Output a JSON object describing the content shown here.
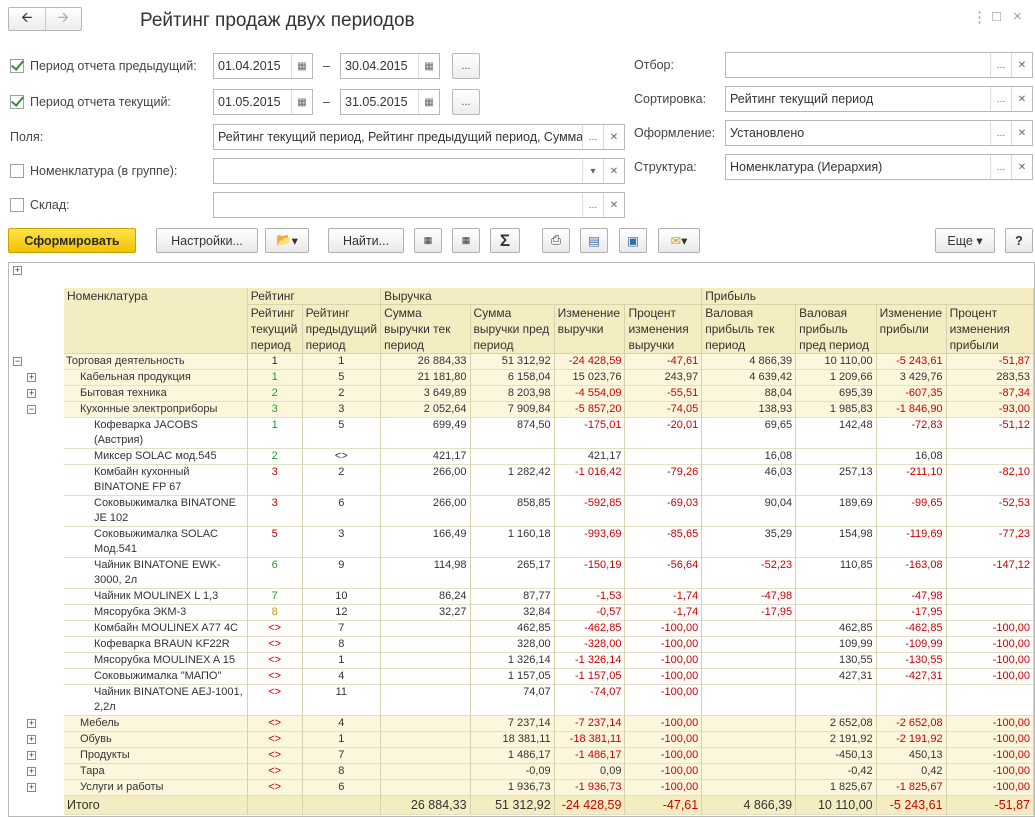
{
  "window": {
    "title": "Рейтинг продаж двух периодов",
    "back_icon": "arrow-left-icon",
    "fwd_icon": "arrow-right-icon",
    "more": "⋮",
    "maximize": "□",
    "close": "×"
  },
  "filters": {
    "prev_period": {
      "label": "Период отчета предыдущий:",
      "from": "01.04.2015",
      "to": "30.04.2015",
      "checked": true
    },
    "cur_period": {
      "label": "Период отчета текущий:",
      "from": "01.05.2015",
      "to": "31.05.2015",
      "checked": true
    },
    "dash": "–",
    "fields": {
      "label": "Поля:",
      "value": "Рейтинг текущий период, Рейтинг предыдущий период, Сумма"
    },
    "nomenclature": {
      "label": "Номенклатура (в группе):",
      "value": ""
    },
    "warehouse": {
      "label": "Склад:",
      "value": ""
    },
    "selection": {
      "label": "Отбор:",
      "value": ""
    },
    "sort": {
      "label": "Сортировка:",
      "value": "Рейтинг текущий период"
    },
    "design": {
      "label": "Оформление:",
      "value": "Установлено"
    },
    "structure": {
      "label": "Структура:",
      "value": "Номенклатура (Иерархия)"
    }
  },
  "toolbar": {
    "generate": "Сформировать",
    "settings": "Настройки...",
    "find": "Найти...",
    "more": "Еще",
    "help": "?"
  },
  "table": {
    "headers": {
      "nom": "Номенклатура",
      "rating": "Рейтинг",
      "revenue": "Выручка",
      "profit": "Прибыль",
      "r_cur": "Рейтинг текущий период",
      "r_prev": "Рейтинг предыдущий период",
      "rev_cur": "Сумма выручки тек период",
      "rev_prev": "Сумма выручки пред период",
      "rev_chg": "Изменение выручки",
      "rev_pct": "Процент изменения выручки",
      "pr_cur": "Валовая прибыль тек период",
      "pr_prev": "Валовая прибыль пред период",
      "pr_chg": "Изменение прибыли",
      "pr_pct": "Процент изменения прибыли"
    },
    "rows": [
      {
        "lvl": 0,
        "grp": true,
        "name": "Торговая деятельность",
        "rc": "1",
        "rp": "1",
        "a": "26 884,33",
        "b": "51 312,92",
        "c": "-24 428,59",
        "d": "-47,61",
        "e": "4 866,39",
        "f": "10 110,00",
        "g": "-5 243,61",
        "h": "-51,87"
      },
      {
        "lvl": 1,
        "grp": true,
        "name": "Кабельная продукция",
        "rc": "1",
        "rp": "5",
        "a": "21 181,80",
        "b": "6 158,04",
        "c": "15 023,76",
        "d": "243,97",
        "e": "4 639,42",
        "f": "1 209,66",
        "g": "3 429,76",
        "h": "283,53"
      },
      {
        "lvl": 1,
        "grp": true,
        "name": "Бытовая техника",
        "rc": "2",
        "rp": "2",
        "a": "3 649,89",
        "b": "8 203,98",
        "c": "-4 554,09",
        "d": "-55,51",
        "e": "88,04",
        "f": "695,39",
        "g": "-607,35",
        "h": "-87,34"
      },
      {
        "lvl": 1,
        "grp": true,
        "name": "Кухонные электроприборы",
        "rc": "3",
        "rp": "3",
        "a": "2 052,64",
        "b": "7 909,84",
        "c": "-5 857,20",
        "d": "-74,05",
        "e": "138,93",
        "f": "1 985,83",
        "g": "-1 846,90",
        "h": "-93,00"
      },
      {
        "lvl": 2,
        "name": "Кофеварка JACOBS (Австрия)",
        "rc": "1",
        "rp": "5",
        "a": "699,49",
        "b": "874,50",
        "c": "-175,01",
        "d": "-20,01",
        "e": "69,65",
        "f": "142,48",
        "g": "-72,83",
        "h": "-51,12"
      },
      {
        "lvl": 2,
        "name": "Миксер SOLAC мод.545",
        "rc": "2",
        "rp": "<>",
        "a": "421,17",
        "b": "",
        "c": "421,17",
        "d": "",
        "e": "16,08",
        "f": "",
        "g": "16,08",
        "h": ""
      },
      {
        "lvl": 2,
        "name": "Комбайн кухонный BINATONE FP 67",
        "rc": "3",
        "rp": "2",
        "a": "266,00",
        "b": "1 282,42",
        "c": "-1 016,42",
        "d": "-79,26",
        "e": "46,03",
        "f": "257,13",
        "g": "-211,10",
        "h": "-82,10"
      },
      {
        "lvl": 2,
        "name": "Соковыжималка BINATONE JE 102",
        "rc": "3",
        "rp": "6",
        "a": "266,00",
        "b": "858,85",
        "c": "-592,85",
        "d": "-69,03",
        "e": "90,04",
        "f": "189,69",
        "g": "-99,65",
        "h": "-52,53"
      },
      {
        "lvl": 2,
        "name": "Соковыжималка SOLAC Мод.541",
        "rc": "5",
        "rp": "3",
        "a": "166,49",
        "b": "1 160,18",
        "c": "-993,69",
        "d": "-85,65",
        "e": "35,29",
        "f": "154,98",
        "g": "-119,69",
        "h": "-77,23"
      },
      {
        "lvl": 2,
        "name": "Чайник BINATONE EWK-3000, 2л",
        "rc": "6",
        "rp": "9",
        "a": "114,98",
        "b": "265,17",
        "c": "-150,19",
        "d": "-56,64",
        "e": "-52,23",
        "f": "110,85",
        "g": "-163,08",
        "h": "-147,12"
      },
      {
        "lvl": 2,
        "name": "Чайник MOULINEX L 1,3",
        "rc": "7",
        "rp": "10",
        "a": "86,24",
        "b": "87,77",
        "c": "-1,53",
        "d": "-1,74",
        "e": "-47,98",
        "f": "",
        "g": "-47,98",
        "h": ""
      },
      {
        "lvl": 2,
        "name": "Мясорубка ЭКМ-3",
        "rc": "8",
        "rp": "12",
        "a": "32,27",
        "b": "32,84",
        "c": "-0,57",
        "d": "-1,74",
        "e": "-17,95",
        "f": "",
        "g": "-17,95",
        "h": ""
      },
      {
        "lvl": 2,
        "name": "Комбайн MOULINEX A77 4C",
        "rc": "<>",
        "rp": "7",
        "a": "",
        "b": "462,85",
        "c": "-462,85",
        "d": "-100,00",
        "e": "",
        "f": "462,85",
        "g": "-462,85",
        "h": "-100,00"
      },
      {
        "lvl": 2,
        "name": "Кофеварка BRAUN KF22R",
        "rc": "<>",
        "rp": "8",
        "a": "",
        "b": "328,00",
        "c": "-328,00",
        "d": "-100,00",
        "e": "",
        "f": "109,99",
        "g": "-109,99",
        "h": "-100,00"
      },
      {
        "lvl": 2,
        "name": "Мясорубка MOULINEX A 15",
        "rc": "<>",
        "rp": "1",
        "a": "",
        "b": "1 326,14",
        "c": "-1 326,14",
        "d": "-100,00",
        "e": "",
        "f": "130,55",
        "g": "-130,55",
        "h": "-100,00"
      },
      {
        "lvl": 2,
        "name": "Соковыжималка \"МАПО\"",
        "rc": "<>",
        "rp": "4",
        "a": "",
        "b": "1 157,05",
        "c": "-1 157,05",
        "d": "-100,00",
        "e": "",
        "f": "427,31",
        "g": "-427,31",
        "h": "-100,00"
      },
      {
        "lvl": 2,
        "name": "Чайник BINATONE AEJ-1001, 2,2л",
        "rc": "<>",
        "rp": "11",
        "a": "",
        "b": "74,07",
        "c": "-74,07",
        "d": "-100,00",
        "e": "",
        "f": "",
        "g": "",
        "h": ""
      },
      {
        "lvl": 1,
        "grp": true,
        "name": "Мебель",
        "rc": "<>",
        "rp": "4",
        "a": "",
        "b": "7 237,14",
        "c": "-7 237,14",
        "d": "-100,00",
        "e": "",
        "f": "2 652,08",
        "g": "-2 652,08",
        "h": "-100,00"
      },
      {
        "lvl": 1,
        "grp": true,
        "name": "Обувь",
        "rc": "<>",
        "rp": "1",
        "a": "",
        "b": "18 381,11",
        "c": "-18 381,11",
        "d": "-100,00",
        "e": "",
        "f": "2 191,92",
        "g": "-2 191,92",
        "h": "-100,00"
      },
      {
        "lvl": 1,
        "grp": true,
        "name": "Продукты",
        "rc": "<>",
        "rp": "7",
        "a": "",
        "b": "1 486,17",
        "c": "-1 486,17",
        "d": "-100,00",
        "e": "",
        "f": "-450,13",
        "g": "450,13",
        "h": "-100,00"
      },
      {
        "lvl": 1,
        "grp": true,
        "name": "Тара",
        "rc": "<>",
        "rp": "8",
        "a": "",
        "b": "-0,09",
        "c": "0,09",
        "d": "-100,00",
        "e": "",
        "f": "-0,42",
        "g": "0,42",
        "h": "-100,00"
      },
      {
        "lvl": 1,
        "grp": true,
        "name": "Услуги и работы",
        "rc": "<>",
        "rp": "6",
        "a": "",
        "b": "1 936,73",
        "c": "-1 936,73",
        "d": "-100,00",
        "e": "",
        "f": "1 825,67",
        "g": "-1 825,67",
        "h": "-100,00"
      }
    ],
    "total": {
      "name": "Итого",
      "a": "26 884,33",
      "b": "51 312,92",
      "c": "-24 428,59",
      "d": "-47,61",
      "e": "4 866,39",
      "f": "10 110,00",
      "g": "-5 243,61",
      "h": "-51,87"
    }
  }
}
